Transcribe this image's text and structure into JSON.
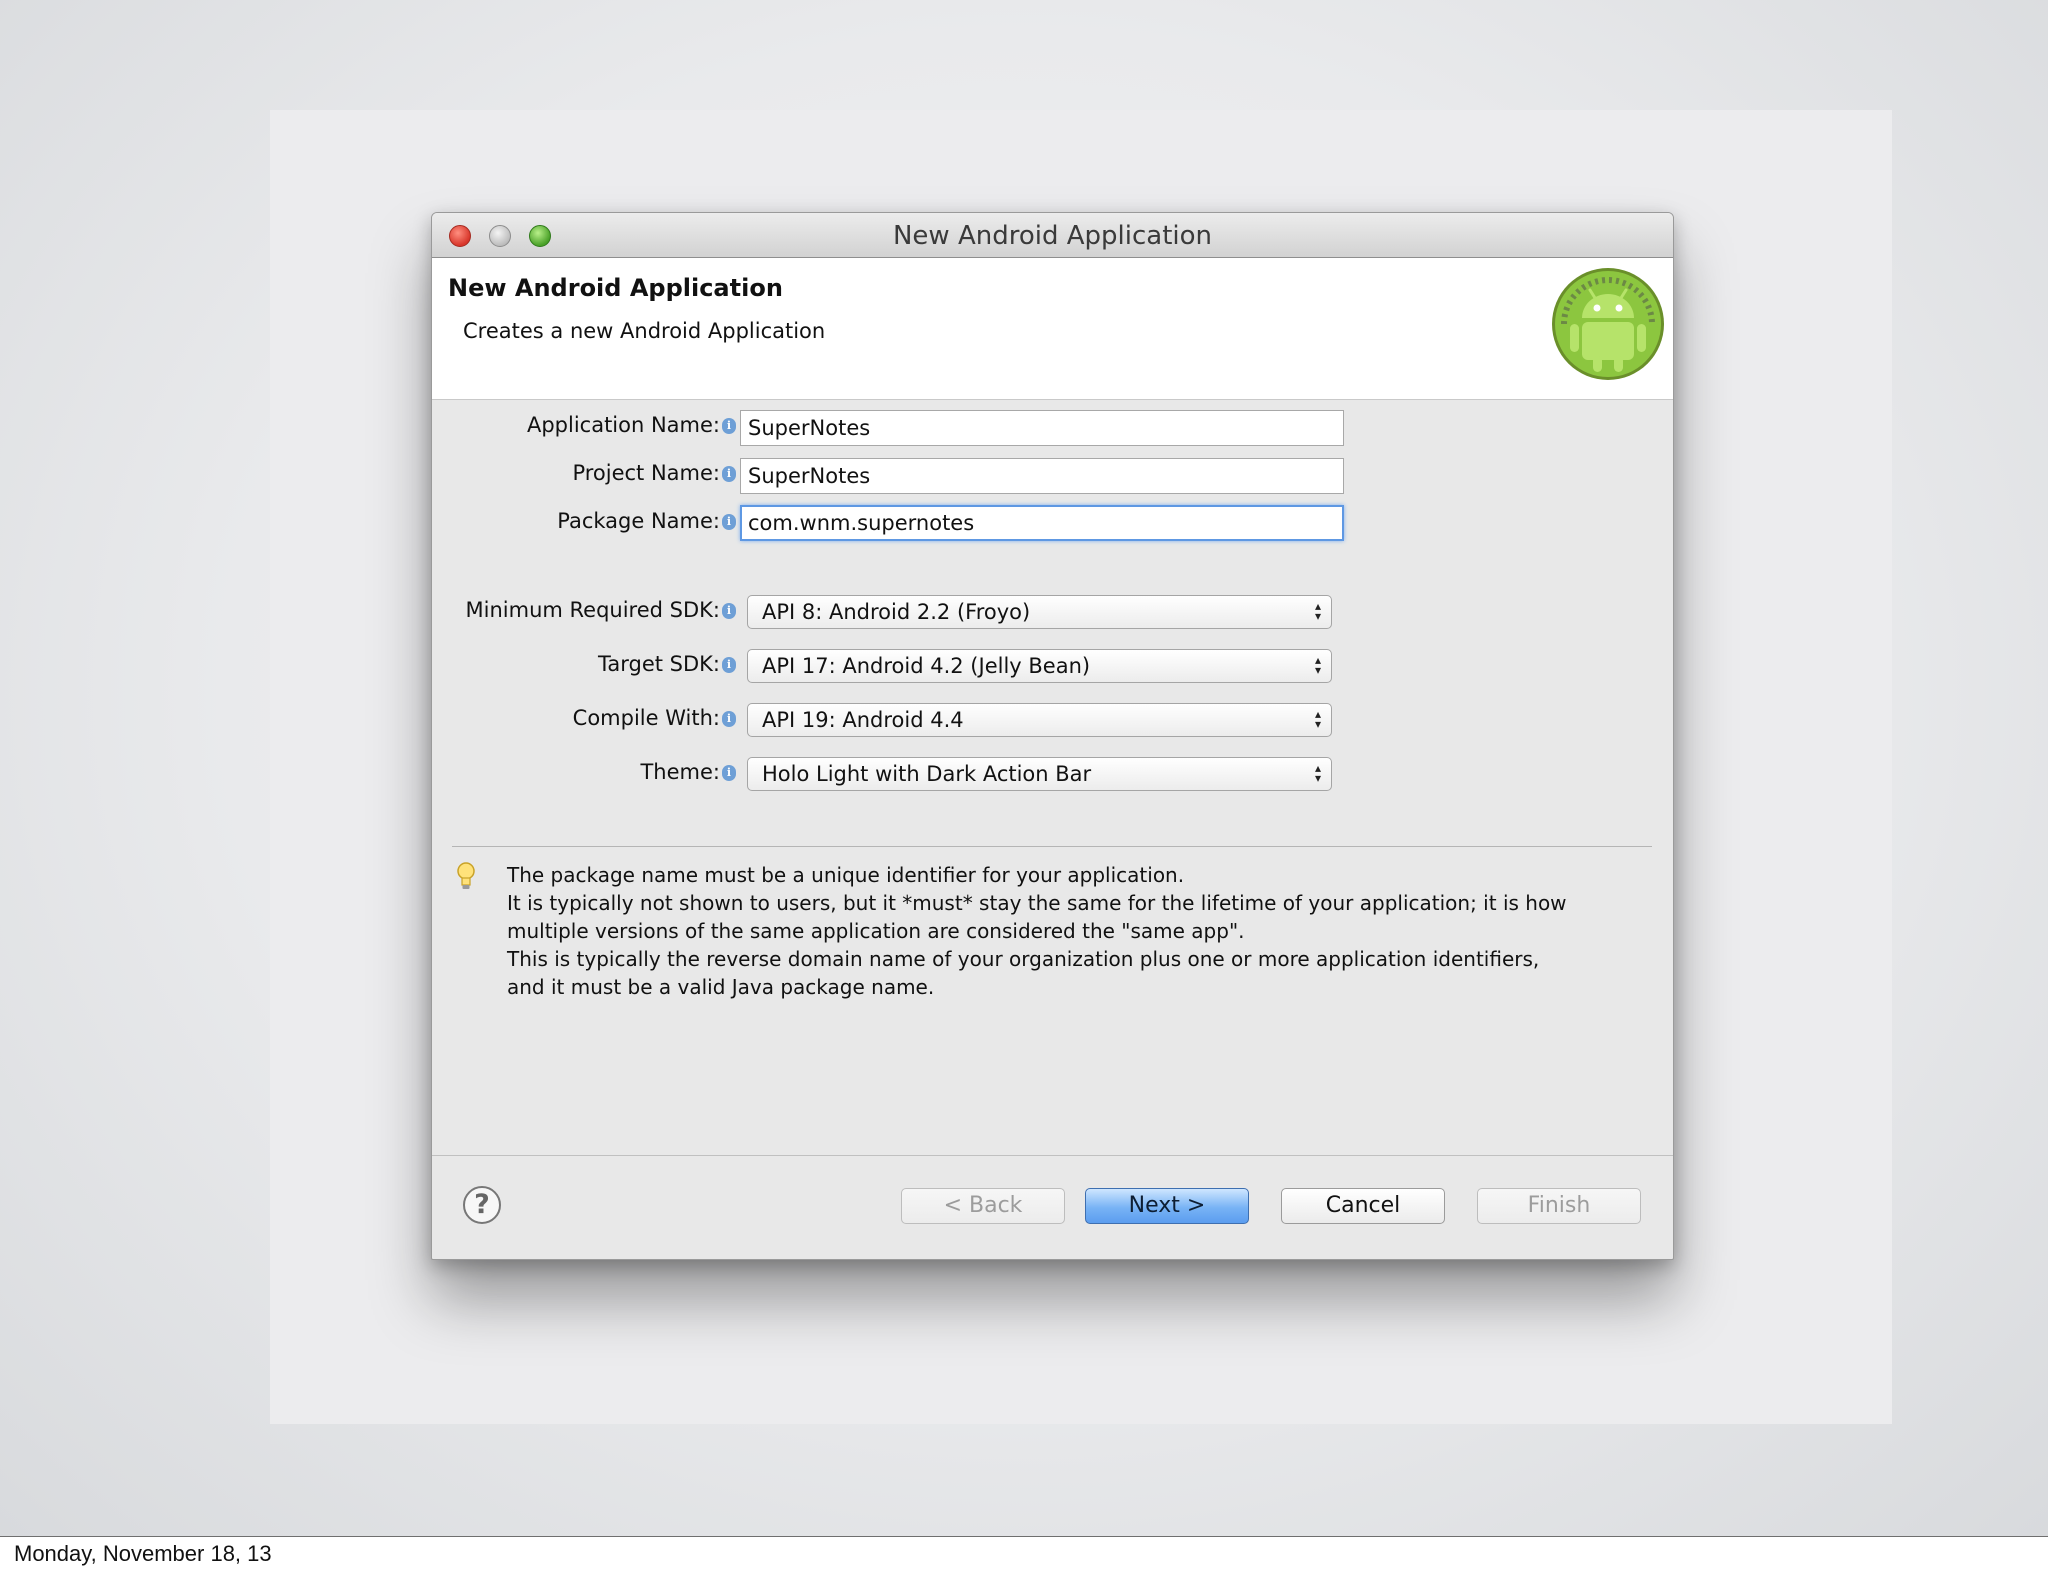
{
  "window": {
    "title": "New Android Application"
  },
  "header": {
    "title": "New Android Application",
    "subtitle": "Creates a new Android Application"
  },
  "form": {
    "app_name_label": "Application Name:",
    "app_name_value": "SuperNotes",
    "project_name_label": "Project Name:",
    "project_name_value": "SuperNotes",
    "package_name_label": "Package Name:",
    "package_name_value": "com.wnm.supernotes",
    "min_sdk_label": "Minimum Required SDK:",
    "min_sdk_value": "API 8: Android 2.2 (Froyo)",
    "target_sdk_label": "Target SDK:",
    "target_sdk_value": "API 17: Android 4.2 (Jelly Bean)",
    "compile_with_label": "Compile With:",
    "compile_with_value": "API 19: Android 4.4",
    "theme_label": "Theme:",
    "theme_value": "Holo Light with Dark Action Bar"
  },
  "hint": {
    "icon": "lightbulb-icon",
    "lines": [
      "The package name must be a unique identifier for your application.",
      "It is typically not shown to users, but it *must* stay the same for the lifetime of your application; it is how",
      "multiple versions of the same application are considered the \"same app\".",
      "This is typically the reverse domain name of your organization plus one or more application identifiers,",
      "and it must be a valid Java package name."
    ]
  },
  "buttons": {
    "help": "?",
    "back": "< Back",
    "next": "Next >",
    "cancel": "Cancel",
    "finish": "Finish"
  },
  "footer": {
    "date": "Monday, November 18, 13"
  },
  "colors": {
    "default_button": "#5b9def",
    "focus_ring": "#5e98e3",
    "android_green": "#8cc63f"
  }
}
